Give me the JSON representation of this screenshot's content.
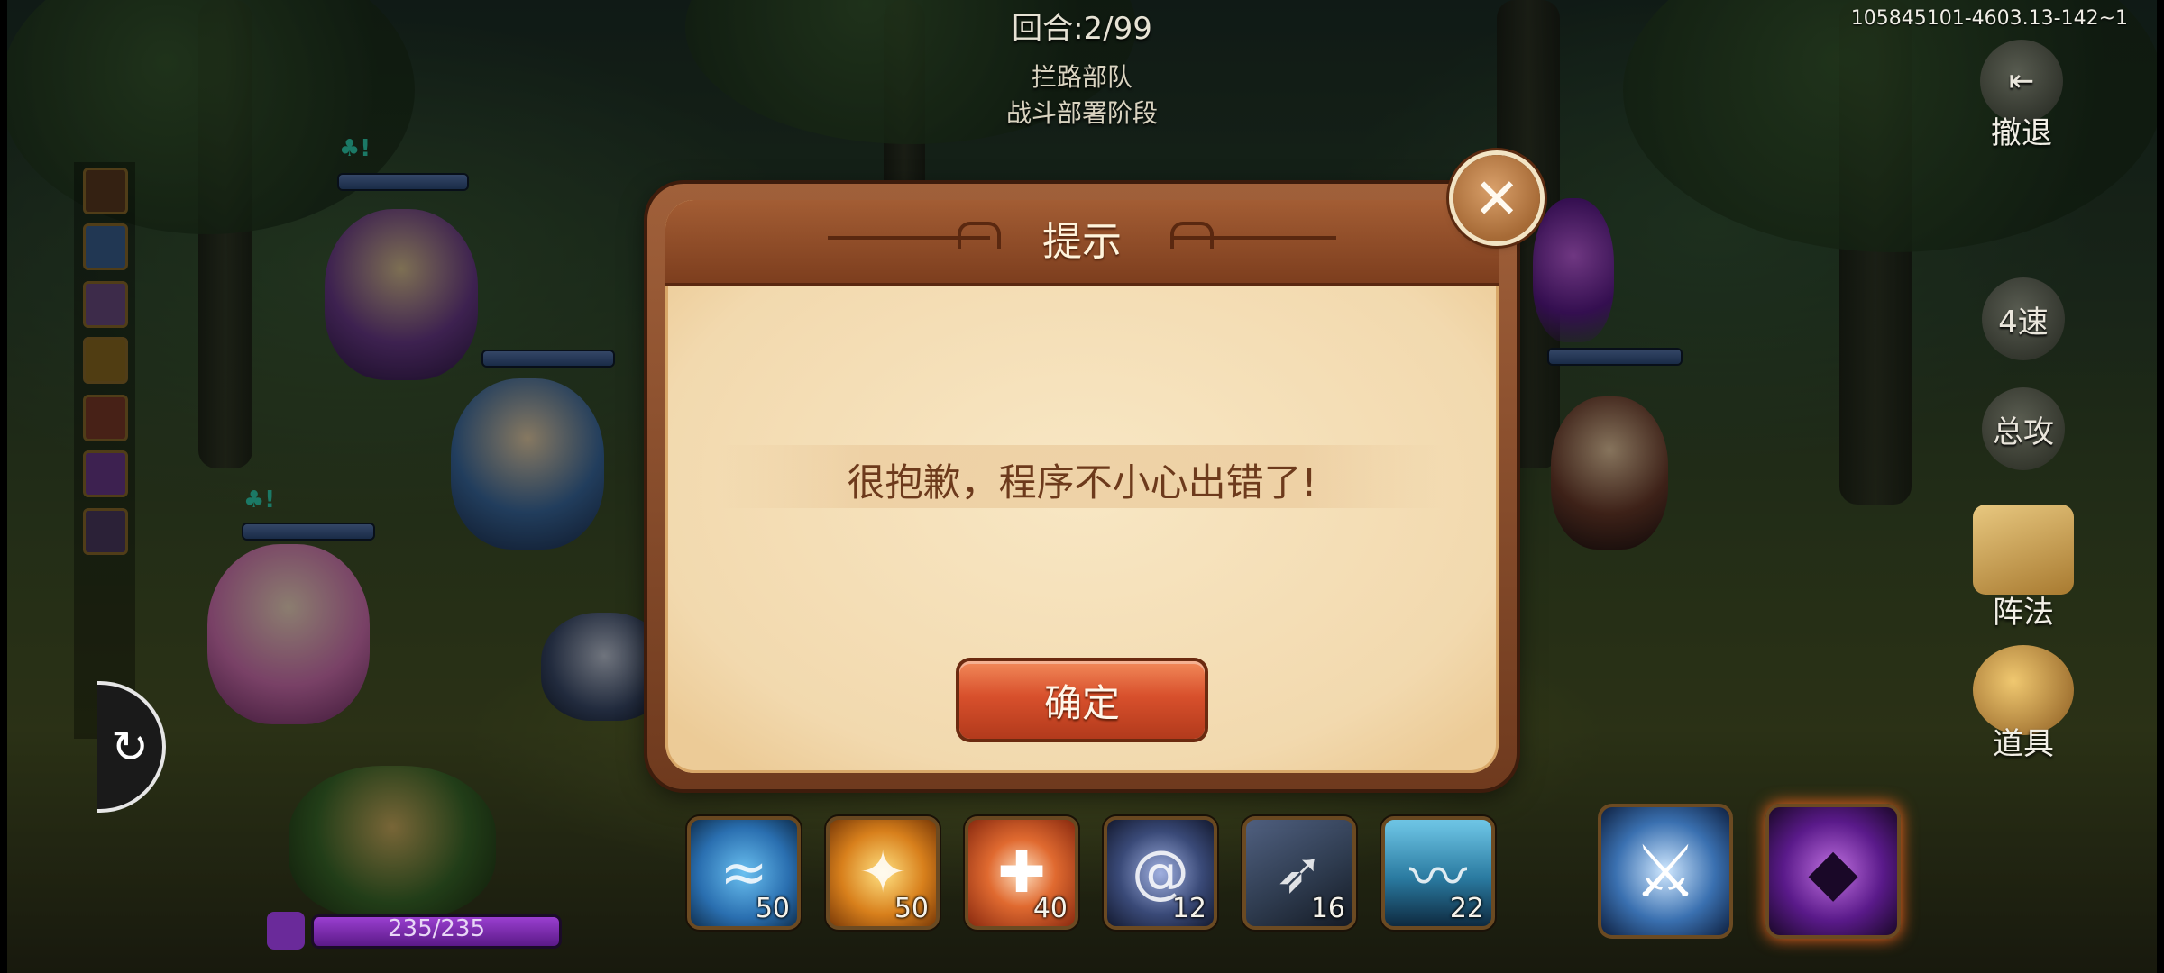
{
  "hud": {
    "round": "回合:2/99",
    "enemy": "拦路部队",
    "phase": "战斗部署阶段",
    "build_id": "105845101-4603.13-142~1"
  },
  "side_buttons": {
    "retreat": "撤退",
    "speed": "4速",
    "all_attack": "总攻",
    "formation": "阵法",
    "items": "道具"
  },
  "hp": {
    "text": "235/235"
  },
  "skills": [
    {
      "name": "wave-skill",
      "count": "50",
      "color": "#2a6fb0"
    },
    {
      "name": "fire-skill",
      "count": "50",
      "color": "#d8801c"
    },
    {
      "name": "heal-skill",
      "count": "40",
      "color": "#c0401c"
    },
    {
      "name": "whirl-skill",
      "count": "12",
      "color": "#3a4a78"
    },
    {
      "name": "arrow-skill",
      "count": "16",
      "color": "#2f3c50"
    },
    {
      "name": "water-skill",
      "count": "22",
      "color": "#2a7aa0"
    }
  ],
  "dialog": {
    "title": "提示",
    "message": "很抱歉，程序不小心出错了!",
    "confirm": "确定",
    "close": "✕"
  }
}
